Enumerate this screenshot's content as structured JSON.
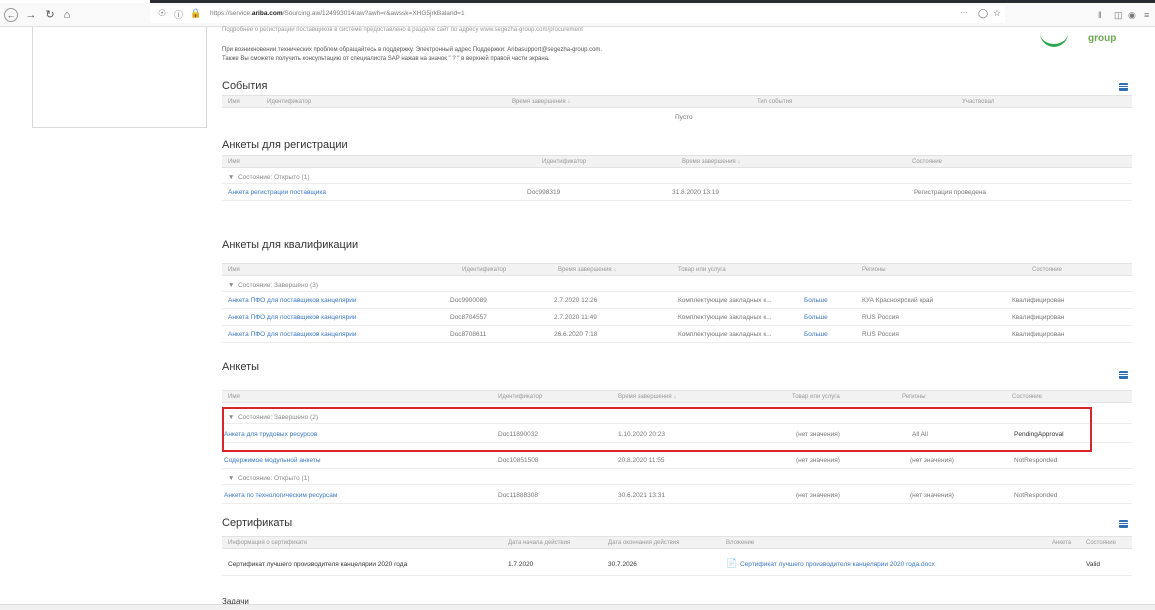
{
  "browser": {
    "url_prefix": "https://service.",
    "url_domain": "ariba.com",
    "url_rest": "/Sourcing.aw/124993014/aw?awh=r&awssk=XHG5jrkBaland=1",
    "icons": [
      "back-arrow-icon",
      "forward-arrow-icon",
      "reload-icon",
      "home-icon",
      "bookmark-star-icon"
    ]
  },
  "notice": {
    "line0": "Подробнее о регистрации поставщиков в системе предоставлено в разделе сайт по адресу www.segezha-group.com/procurement",
    "line1": "При возникновении технических проблем обращайтесь в поддержку. Электронный адрес Поддержки: Aribasupport@segezha-group.com.",
    "line2": "Также Вы сможете получить консультацию от специалиста SAP нажав на значок \" ? \" в верхней правой части экрана."
  },
  "logo": {
    "text": "group"
  },
  "events": {
    "title": "События",
    "headers": [
      "Имя",
      "Идентификатор",
      "Время завершения ↓",
      "Тип события",
      "Участвовал"
    ],
    "empty": "Пусто"
  },
  "registration": {
    "title": "Анкеты для регистрации",
    "headers": [
      "Имя",
      "Идентификатор",
      "Время завершения ↓",
      "Состояние"
    ],
    "group": "Состояние: Открыто (1)",
    "rows": [
      {
        "name": "Анкета регистрации поставщика",
        "id": "Doc998319",
        "time": "31.8.2020 13:19",
        "state": "Регистрация проведена"
      }
    ]
  },
  "qualification": {
    "title": "Анкеты для квалификации",
    "headers": [
      "Имя",
      "Идентификатор",
      "Время завершения ↓",
      "Товар или услуга",
      "Регионы",
      "Состояние"
    ],
    "group": "Состояние: Завершено (3)",
    "more": "Больше",
    "rows": [
      {
        "name": "Анкета ПФО для поставщиков канцелярии",
        "id": "Doc9900089",
        "time": "2.7.2020 12:26",
        "goods": "Комплектующие закладных к...",
        "region": "КУА Красноярский край",
        "state": "Квалифицирован"
      },
      {
        "name": "Анкета ПФО для поставщиков канцелярии",
        "id": "Doc8704557",
        "time": "2.7.2020 11:49",
        "goods": "Комплектующие закладных к...",
        "region": "RUS Россия",
        "state": "Квалифицирован"
      },
      {
        "name": "Анкета ПФО для поставщиков канцелярии",
        "id": "Doc8708611",
        "time": "26.6.2020 7:18",
        "goods": "Комплектующие закладных к...",
        "region": "RUS Россия",
        "state": "Квалифицирован"
      }
    ]
  },
  "questionnaires": {
    "title": "Анкеты",
    "headers": [
      "Имя",
      "Идентификатор",
      "Время завершения ↓",
      "Товар или услуга",
      "Регионы",
      "Состояние"
    ],
    "group1": "Состояние: Завершено (2)",
    "group2": "Состояние: Открыто (1)",
    "rows": [
      {
        "name": "Анкета для трудовых ресурсов",
        "id": "Doc11890032",
        "time": "1.10.2020 20:23",
        "goods": "(нет значения)",
        "region": "All All",
        "state": "PendingApproval"
      },
      {
        "name": "Содержимое модульной анкеты",
        "id": "Doc10851508",
        "time": "20.8.2020 11:55",
        "goods": "(нет значения)",
        "region": "(нет значения)",
        "state": "NotResponded"
      },
      {
        "name": "Анкета по технологическим ресурсам",
        "id": "Doc11888308",
        "time": "30.6.2021 13:31",
        "goods": "(нет значения)",
        "region": "(нет значения)",
        "state": "NotResponded"
      }
    ]
  },
  "certificates": {
    "title": "Сертификаты",
    "headers": [
      "Информация о сертификате",
      "Дата начала действия",
      "Дата окончания действия",
      "Вложение",
      "Анкета",
      "Состояние"
    ],
    "rows": [
      {
        "info": "Сертификат лучшего производителя канцелярии 2020 года",
        "start": "1.7.2020",
        "end": "30.7.2026",
        "attachment": "Сертификат лучшего производителя канцелярии 2020 года.docx",
        "state": "Valid"
      }
    ]
  },
  "tasks": {
    "title": "Задачи"
  },
  "colors": {
    "link": "#3a77c4",
    "highlight": "#d9262a",
    "accent": "#2f6fb3"
  }
}
